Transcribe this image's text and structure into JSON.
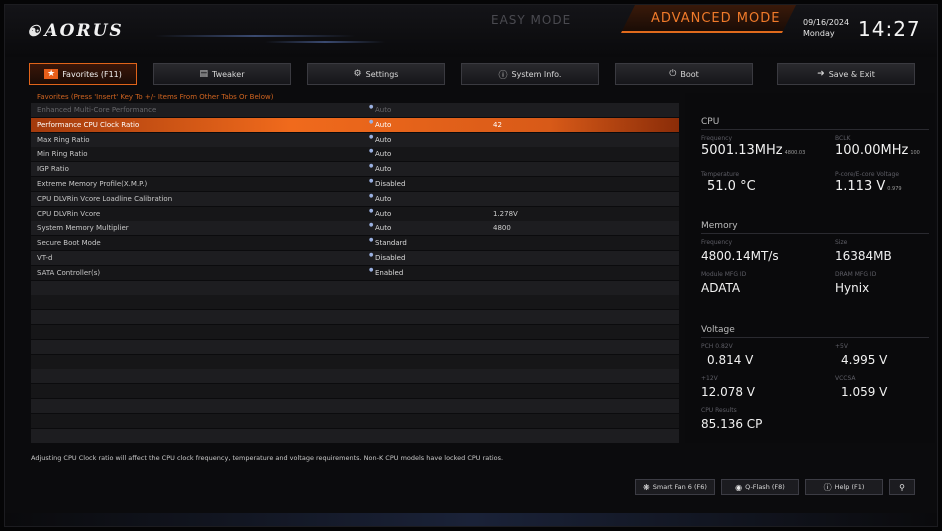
{
  "header": {
    "logo": "AORUS",
    "easy_mode": "EASY MODE",
    "advanced_mode": "ADVANCED MODE",
    "date": "09/16/2024",
    "day": "Monday",
    "time": "14:27"
  },
  "tabs": [
    {
      "label": "Favorites (F11)",
      "icon": "star-icon"
    },
    {
      "label": "Tweaker",
      "icon": "tweaker-icon"
    },
    {
      "label": "Settings",
      "icon": "gear-icon"
    },
    {
      "label": "System Info.",
      "icon": "info-icon"
    },
    {
      "label": "Boot",
      "icon": "power-icon"
    },
    {
      "label": "Save & Exit",
      "icon": "exit-icon"
    }
  ],
  "favorites_hint": "Favorites (Press 'Insert' Key To +/- Items From Other Tabs Or Below)",
  "settings": [
    {
      "label": "Enhanced Multi-Core Performance",
      "value": "Auto",
      "extra": ""
    },
    {
      "label": "Performance CPU Clock Ratio",
      "value": "Auto",
      "extra": "42"
    },
    {
      "label": "Max Ring Ratio",
      "value": "Auto",
      "extra": ""
    },
    {
      "label": "Min Ring Ratio",
      "value": "Auto",
      "extra": ""
    },
    {
      "label": "IGP Ratio",
      "value": "Auto",
      "extra": ""
    },
    {
      "label": "Extreme Memory Profile(X.M.P.)",
      "value": "Disabled",
      "extra": ""
    },
    {
      "label": "CPU DLVRin Vcore Loadline Calibration",
      "value": "Auto",
      "extra": ""
    },
    {
      "label": "CPU DLVRin Vcore",
      "value": "Auto",
      "extra": "1.278V"
    },
    {
      "label": "System Memory Multiplier",
      "value": "Auto",
      "extra": "4800"
    },
    {
      "label": "Secure Boot Mode",
      "value": "Standard",
      "extra": ""
    },
    {
      "label": "VT-d",
      "value": "Disabled",
      "extra": ""
    },
    {
      "label": "SATA Controller(s)",
      "value": "Enabled",
      "extra": ""
    }
  ],
  "cpu": {
    "title": "CPU",
    "frequency_label": "Frequency",
    "frequency": "5001.13MHz",
    "frequency_sub": "4800.03",
    "bclk_label": "BCLK",
    "bclk": "100.00MHz",
    "bclk_sub": "100",
    "temperature_label": "Temperature",
    "temperature": "51.0 °C",
    "voltage_label": "P-core/E-core Voltage",
    "voltage": "1.113 V",
    "voltage_sub": "0.979"
  },
  "memory": {
    "title": "Memory",
    "frequency_label": "Frequency",
    "frequency": "4800.14MT/s",
    "size_label": "Size",
    "size": "16384MB",
    "module_label": "Module MFG ID",
    "module": "ADATA",
    "dram_label": "DRAM MFG ID",
    "dram": "Hynix"
  },
  "voltage": {
    "title": "Voltage",
    "pch_label": "PCH 0.82V",
    "pch": "0.814 V",
    "v5_label": "+5V",
    "v5": "4.995 V",
    "v12_label": "+12V",
    "v12": "12.078 V",
    "vccsa_label": "VCCSA",
    "vccsa": "1.059 V",
    "cpu_result_label": "CPU Results",
    "cpu_result": "85.136 CP"
  },
  "description": "Adjusting CPU Clock ratio will affect the CPU clock frequency, temperature and voltage requirements. Non-K CPU models have locked CPU ratios.",
  "buttons": {
    "smart_fan": "Smart Fan 6 (F6)",
    "qflash": "Q-Flash (F8)",
    "help": "Help (F1)"
  },
  "colors": {
    "accent": "#f06a1c",
    "background": "#0b0b0d"
  }
}
